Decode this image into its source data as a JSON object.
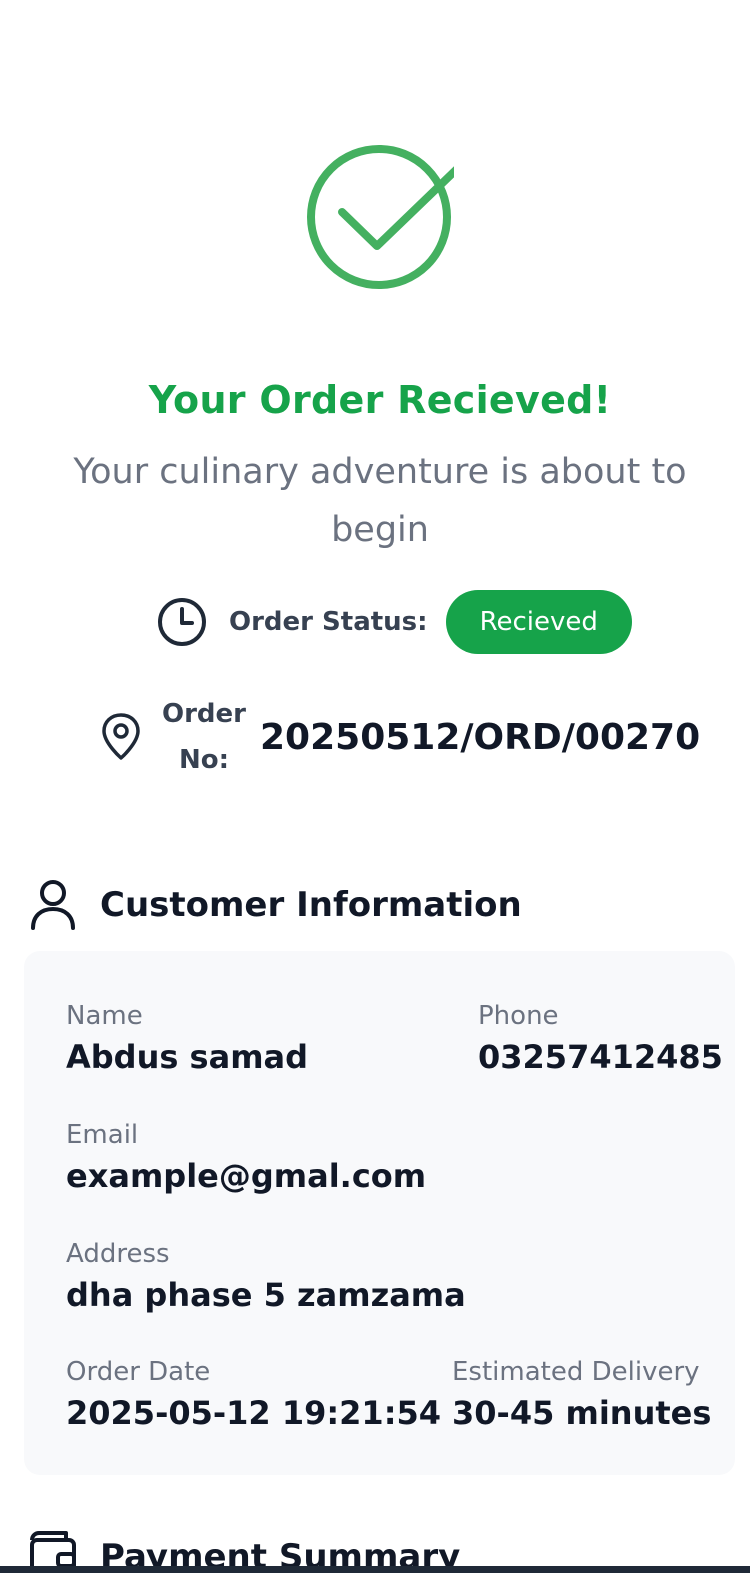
{
  "hero": {
    "icon": "check-circle-icon",
    "accent_color": "#16a34a",
    "icon_color": "#44b060",
    "title": "Your Order Recieved!",
    "subtitle": "Your culinary adventure is about to begin"
  },
  "status": {
    "icon": "clock-icon",
    "label": "Order Status:",
    "value": "Recieved",
    "badge_color": "#16a34a"
  },
  "order": {
    "icon": "map-pin-icon",
    "label": "Order No:",
    "number": "20250512/ORD/00270"
  },
  "customer": {
    "heading": "Customer Information",
    "icon": "user-icon",
    "fields": {
      "name": {
        "label": "Name",
        "value": "Abdus samad"
      },
      "phone": {
        "label": "Phone",
        "value": "03257412485"
      },
      "email": {
        "label": "Email",
        "value": "example@gmal.com"
      },
      "address": {
        "label": "Address",
        "value": "dha phase 5 zamzama"
      },
      "order_date": {
        "label": "Order Date",
        "value": "2025-05-12 19:21:54"
      },
      "estimated_delivery": {
        "label": "Estimated Delivery",
        "value": "30-45 minutes"
      }
    }
  },
  "payment": {
    "heading": "Payment Summary",
    "icon": "wallet-icon"
  }
}
